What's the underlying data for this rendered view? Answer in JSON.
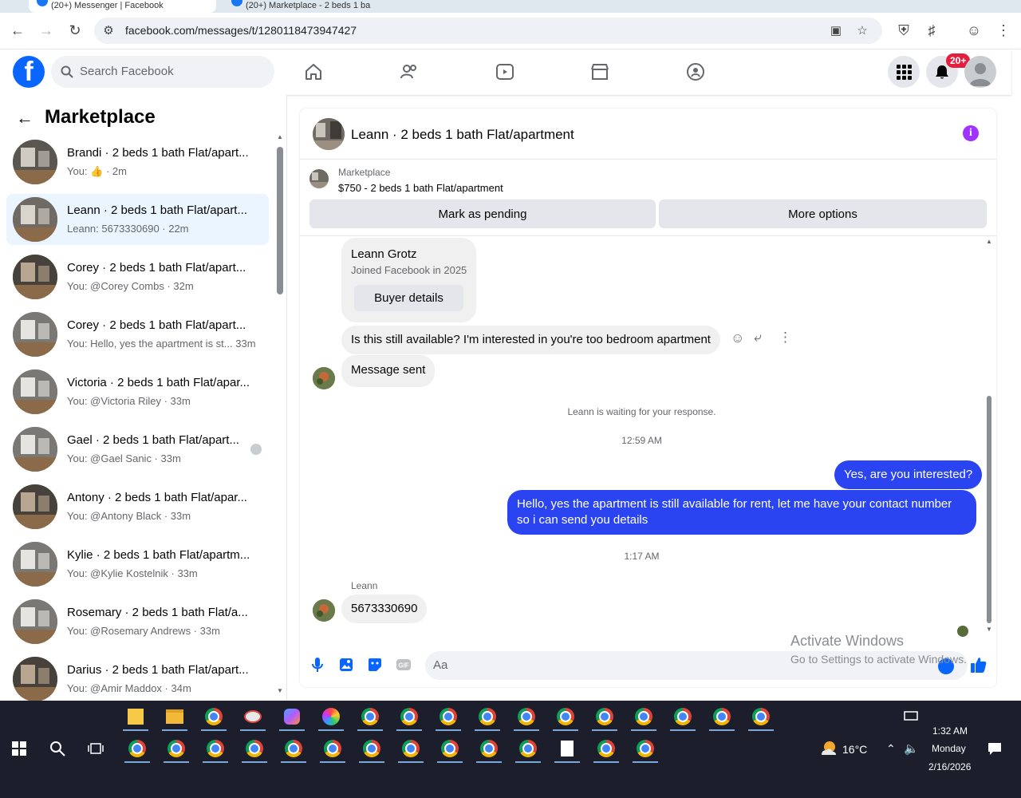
{
  "browser": {
    "tabs": [
      {
        "label": "(20+) Messenger | Facebook"
      },
      {
        "label": "(20+) Marketplace - 2 beds 1 ba"
      }
    ],
    "url": "facebook.com/messages/t/1280118473947427"
  },
  "header": {
    "search_placeholder": "Search Facebook",
    "notif_badge": "20+"
  },
  "sidebar": {
    "title": "Marketplace",
    "conversations": [
      {
        "title": "Brandi · 2 beds 1 bath Flat/apart...",
        "sub": "You: 👍 · 2m",
        "active": false
      },
      {
        "title": "Leann · 2 beds 1 bath Flat/apart...",
        "sub": "Leann: 5673330690 · 22m",
        "active": true
      },
      {
        "title": "Corey · 2 beds 1 bath Flat/apart...",
        "sub": "You: @Corey Combs · 32m",
        "active": false
      },
      {
        "title": "Corey · 2 beds 1 bath Flat/apart...",
        "sub": "You: Hello, yes the apartment is st... 33m",
        "active": false
      },
      {
        "title": "Victoria · 2 beds 1 bath Flat/apar...",
        "sub": "You: @Victoria Riley · 33m",
        "active": false
      },
      {
        "title": "Gael · 2 beds 1 bath Flat/apart...",
        "sub": "You: @Gael Sanic · 33m",
        "active": false
      },
      {
        "title": "Antony · 2 beds 1 bath Flat/apar...",
        "sub": "You: @Antony Black · 33m",
        "active": false
      },
      {
        "title": "Kylie · 2 beds 1 bath Flat/apartm...",
        "sub": "You: @Kylie Kostelnik · 33m",
        "active": false
      },
      {
        "title": "Rosemary · 2 beds 1 bath Flat/a...",
        "sub": "You: @Rosemary Andrews · 33m",
        "active": false
      },
      {
        "title": "Darius · 2 beds 1 bath Flat/apart...",
        "sub": "You: @Amir Maddox · 34m",
        "active": false
      }
    ]
  },
  "chat": {
    "title": "Leann · 2 beds 1 bath Flat/apartment",
    "listing_label": "Marketplace",
    "listing_price": "$750 - 2 beds 1 bath Flat/apartment",
    "btn_pending": "Mark as pending",
    "btn_more": "More options",
    "profile_name": "Leann Grotz",
    "profile_joined": "Joined Facebook in 2025",
    "buyer_details": "Buyer details",
    "msg1": "Is this still available? I'm interested in you're too bedroom apartment",
    "msg2": "Message sent",
    "waiting": "Leann is waiting for your response.",
    "time1": "12:59 AM",
    "msg3": "Yes, are you interested?",
    "msg4": "Hello, yes the apartment is still available for rent, let me have your contact number so i can send you details",
    "time2": "1:17 AM",
    "sender": "Leann",
    "msg5": "5673330690",
    "composer_placeholder": "Aa"
  },
  "watermark": {
    "line1": "Activate Windows",
    "line2": "Go to Settings to activate Windows."
  },
  "tray": {
    "temp": "16°C",
    "time": "1:32 AM",
    "day": "Monday",
    "date": "2/16/2026"
  },
  "colors": {
    "fb_blue": "#0866ff",
    "bubble_blue": "#2a44f2",
    "active_conv": "#ebf5ff"
  }
}
